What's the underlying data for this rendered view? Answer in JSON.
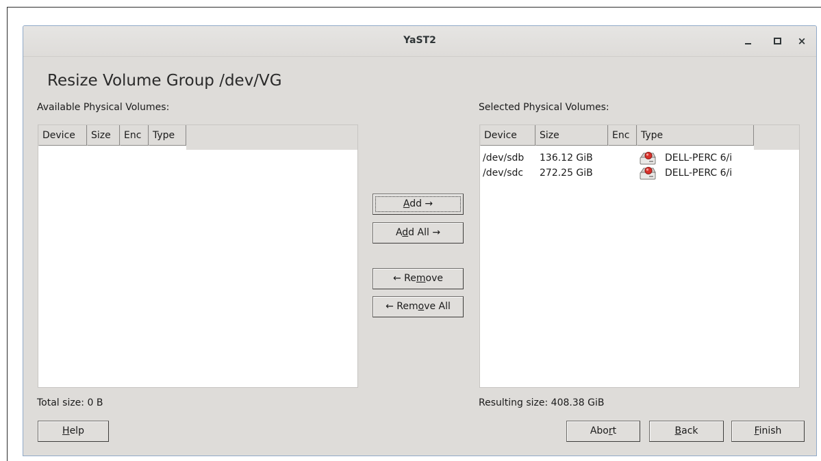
{
  "window": {
    "title": "YaST2"
  },
  "heading": "Resize Volume Group /dev/VG",
  "available": {
    "label": "Available Physical Volumes:",
    "columns": [
      "Device",
      "Size",
      "Enc",
      "Type"
    ],
    "rows": [],
    "total": "Total size: 0 B"
  },
  "selected": {
    "label": "Selected Physical Volumes:",
    "columns": [
      "Device",
      "Size",
      "Enc",
      "Type"
    ],
    "rows": [
      {
        "device": "/dev/sdb",
        "size": "136.12 GiB",
        "enc": "",
        "type": "DELL-PERC 6/i",
        "icon": "hard-disk-icon"
      },
      {
        "device": "/dev/sdc",
        "size": "272.25 GiB",
        "enc": "",
        "type": "DELL-PERC 6/i",
        "icon": "hard-disk-icon"
      }
    ],
    "resulting": "Resulting size: 408.38 GiB"
  },
  "actions": {
    "add": {
      "pre": "",
      "key": "A",
      "post": "dd →"
    },
    "add_all": {
      "pre": "A",
      "key": "d",
      "post": "d All →"
    },
    "remove": {
      "pre": "← Re",
      "key": "m",
      "post": "ove"
    },
    "remove_all": {
      "pre": "← Rem",
      "key": "o",
      "post": "ve All"
    }
  },
  "footer": {
    "help": {
      "pre": "",
      "key": "H",
      "post": "elp"
    },
    "abort": {
      "pre": "Abo",
      "key": "r",
      "post": "t"
    },
    "back": {
      "pre": "",
      "key": "B",
      "post": "ack"
    },
    "finish": {
      "pre": "",
      "key": "F",
      "post": "inish"
    }
  },
  "colors": {
    "window_bg": "#dedcd9",
    "list_bg": "#ffffff",
    "titlebar_border": "#8fa9c8",
    "disk_red": "#d9312b"
  }
}
